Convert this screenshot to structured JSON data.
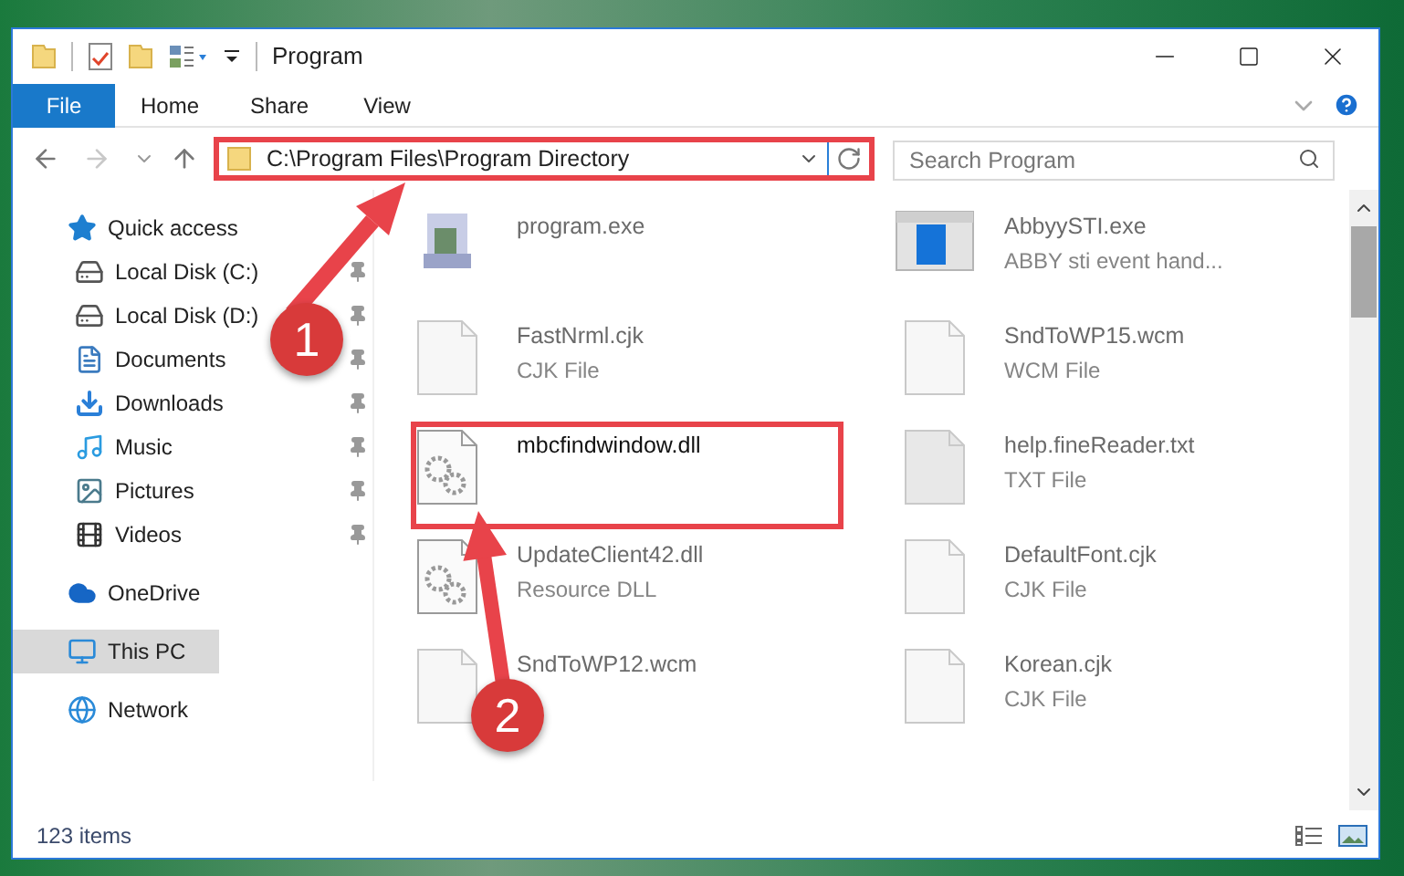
{
  "window": {
    "title": "Program"
  },
  "ribbon_tabs": [
    {
      "label": "File",
      "selected": true
    },
    {
      "label": "Home",
      "selected": false
    },
    {
      "label": "Share",
      "selected": false
    },
    {
      "label": "View",
      "selected": false
    }
  ],
  "address_bar": {
    "value": "C:\\Program Files\\Program Directory"
  },
  "search": {
    "placeholder": "Search Program"
  },
  "sidebar": {
    "items": [
      {
        "label": "Quick access",
        "kind": "star",
        "selected": false,
        "children": [
          {
            "label": "Local Disk (C:)",
            "kind": "drive-c",
            "pinned": true,
            "selected": false
          },
          {
            "label": "Local Disk (D:)",
            "kind": "drive",
            "pinned": true,
            "selected": false
          },
          {
            "label": "Documents",
            "kind": "documents",
            "pinned": true,
            "selected": false
          },
          {
            "label": "Downloads",
            "kind": "downloads",
            "pinned": true,
            "selected": false
          },
          {
            "label": "Music",
            "kind": "music",
            "pinned": true,
            "selected": false
          },
          {
            "label": "Pictures",
            "kind": "pictures",
            "pinned": true,
            "selected": false
          },
          {
            "label": "Videos",
            "kind": "videos",
            "pinned": true,
            "selected": false
          }
        ]
      },
      {
        "label": "OneDrive",
        "kind": "cloud",
        "selected": false
      },
      {
        "label": "This PC",
        "kind": "pc",
        "selected": true
      },
      {
        "label": "Network",
        "kind": "network",
        "selected": false
      }
    ]
  },
  "files": [
    {
      "name": "program.exe",
      "kind": "installer",
      "blurred": true
    },
    {
      "name": "AbbyySTI.exe",
      "type": "ABBY sti event hand...",
      "kind": "app",
      "blurred": true
    },
    {
      "name": "FastNrml.cjk",
      "type": "CJK File",
      "kind": "doc",
      "blurred": true
    },
    {
      "name": "SndToWP15.wcm",
      "type": "WCM File",
      "kind": "doc",
      "blurred": true
    },
    {
      "name": "mbcfindwindow.dll",
      "kind": "gear",
      "blurred": false
    },
    {
      "name": "help.fineReader.txt",
      "type": "TXT File",
      "kind": "doc-grey",
      "blurred": true
    },
    {
      "name": "UpdateClient42.dll",
      "type": "Resource DLL",
      "kind": "gear",
      "blurred": true
    },
    {
      "name": "DefaultFont.cjk",
      "type": "CJK File",
      "kind": "doc",
      "blurred": true
    },
    {
      "name": "SndToWP12.wcm",
      "kind": "doc",
      "blurred": true
    },
    {
      "name": "Korean.cjk",
      "type": "CJK File",
      "kind": "doc",
      "blurred": true
    }
  ],
  "status_bar": {
    "item_count": "123 items"
  },
  "annotations": [
    {
      "number": "1"
    },
    {
      "number": "2"
    }
  ]
}
